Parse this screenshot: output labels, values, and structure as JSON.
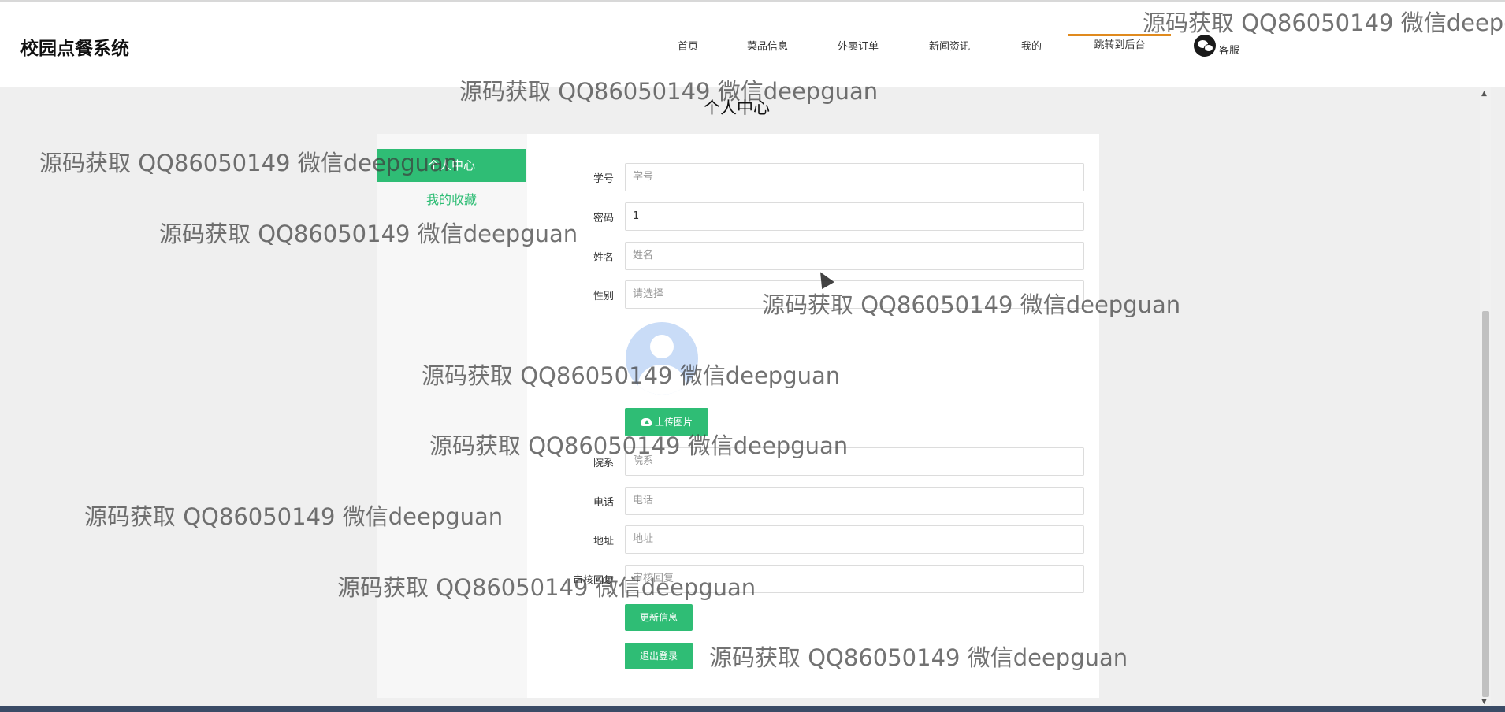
{
  "header": {
    "brand": "校园点餐系统",
    "nav": [
      "首页",
      "菜品信息",
      "外卖订单",
      "新闻资讯",
      "我的",
      "跳转到后台"
    ],
    "service_label": "客服"
  },
  "page_title": "个人中心",
  "sidebar": {
    "items": [
      "个人中心",
      "我的收藏"
    ]
  },
  "form": {
    "fields": [
      {
        "label": "学号",
        "value": "",
        "placeholder": "学号"
      },
      {
        "label": "密码",
        "value": "1",
        "placeholder": ""
      },
      {
        "label": "姓名",
        "value": "",
        "placeholder": "姓名"
      },
      {
        "label": "性别",
        "value": "",
        "placeholder": "请选择"
      },
      {
        "label": "院系",
        "value": "",
        "placeholder": "院系"
      },
      {
        "label": "电话",
        "value": "",
        "placeholder": "电话"
      },
      {
        "label": "地址",
        "value": "",
        "placeholder": "地址"
      },
      {
        "label": "审核回复",
        "value": "",
        "placeholder": "审核回复"
      }
    ],
    "upload_label": "上传图片",
    "update_label": "更新信息",
    "logout_label": "退出登录"
  },
  "watermark": "源码获取 QQ86050149 微信deepguan",
  "colors": {
    "accent": "#2fbd75",
    "admin_underline": "#e08a1e"
  },
  "icons": [
    "wechat-icon",
    "cloud-upload-icon",
    "avatar-placeholder",
    "mouse-cursor-icon"
  ]
}
